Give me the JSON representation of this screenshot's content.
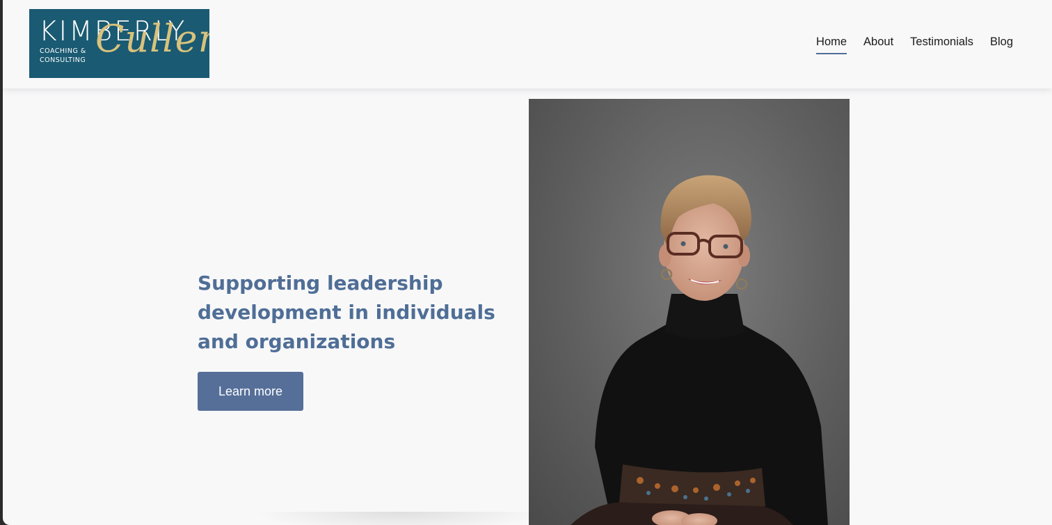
{
  "header": {
    "logo": {
      "main": "KIMBERLY",
      "sub_line1": "COACHING &",
      "sub_line2": "CONSULTING",
      "script": "Cullen"
    },
    "nav": [
      {
        "label": "Home",
        "active": true
      },
      {
        "label": "About",
        "active": false
      },
      {
        "label": "Testimonials",
        "active": false
      },
      {
        "label": "Blog",
        "active": false
      }
    ]
  },
  "hero": {
    "headline": "Supporting leadership development in individuals and organizations",
    "cta_label": "Learn more",
    "photo_alt": "portrait-photo"
  },
  "colors": {
    "logo_bg": "#1a5a72",
    "logo_script": "#d9c27c",
    "accent": "#4f6e96",
    "button": "#566f99",
    "page_bg": "#f8f8f9"
  }
}
